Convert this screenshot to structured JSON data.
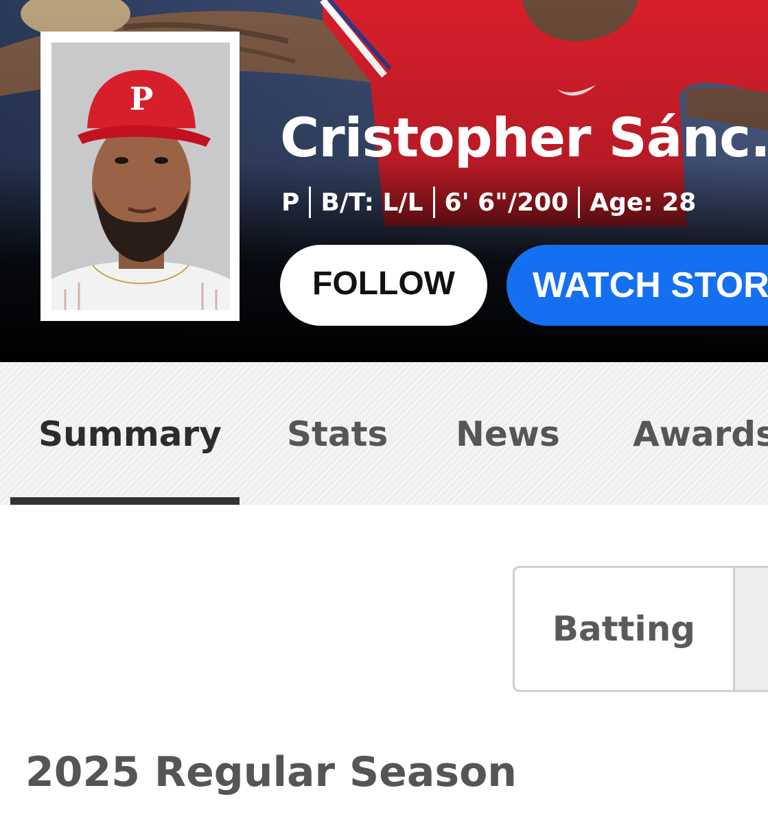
{
  "player": {
    "name": "Cristopher Sánc...",
    "position": "P",
    "bats_throws": "B/T: L/L",
    "height_weight": "6' 6\"/200",
    "age": "Age: 28",
    "cap_logo": "P"
  },
  "actions": {
    "follow_label": "FOLLOW",
    "watch_label": "WATCH STOR"
  },
  "tabs": [
    {
      "label": "Summary",
      "active": true
    },
    {
      "label": "Stats"
    },
    {
      "label": "News"
    },
    {
      "label": "Awards"
    }
  ],
  "segmented": {
    "options": [
      "Batting"
    ]
  },
  "section": {
    "heading": "2025 Regular Season"
  },
  "colors": {
    "jersey_red": "#d71f2b",
    "accent_blue": "#1470f0",
    "tab_indicator": "#333333"
  }
}
